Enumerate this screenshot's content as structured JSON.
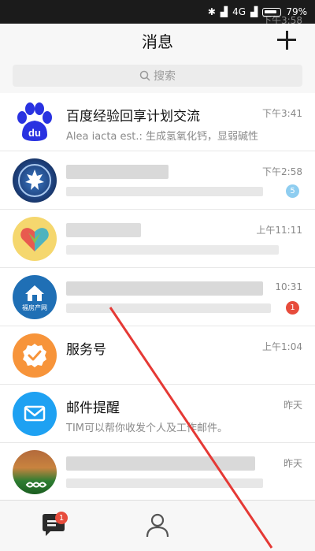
{
  "statusbar": {
    "time": "下午3:58",
    "network": "4G",
    "battery": "79%"
  },
  "header": {
    "title": "消息"
  },
  "search": {
    "placeholder": "搜索"
  },
  "conversations": [
    {
      "name": "百度经验回享计划交流",
      "preview": "Alea iacta est.: 生成氢氧化钙，显弱碱性",
      "time": "下午3:41"
    },
    {
      "name": "",
      "preview": "",
      "time": "下午2:58",
      "badge": "5"
    },
    {
      "name": "",
      "preview": "",
      "time": "上午11:11"
    },
    {
      "name": "",
      "preview": "",
      "time": "10:31",
      "badge": "1"
    },
    {
      "name": "服务号",
      "preview": "",
      "time": "上午1:04"
    },
    {
      "name": "邮件提醒",
      "preview": "TIM可以帮你收发个人及工作邮件。",
      "time": "昨天"
    },
    {
      "name": "",
      "preview": "",
      "time": "昨天"
    }
  ],
  "avatar_texts": {
    "baidu": "du",
    "house": "福房产网"
  },
  "bottom_nav": {
    "messages_badge": "1"
  },
  "colors": {
    "status_bar": "#1b1b1b",
    "header_bg": "#f7f7f7",
    "badge_blue": "#8ecdf0",
    "badge_red": "#e74c3c",
    "arrow": "#e53935"
  }
}
